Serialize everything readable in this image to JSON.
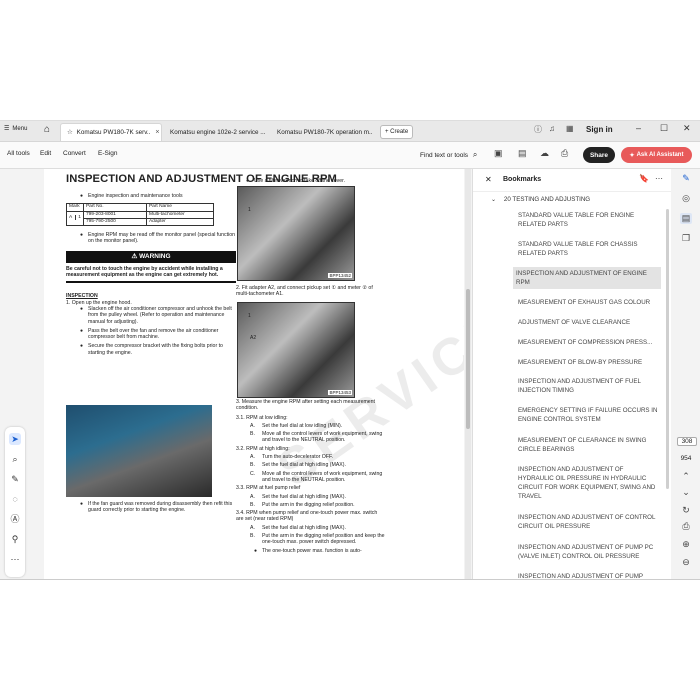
{
  "tabbar": {
    "menu_label": "Menu",
    "tabs": [
      {
        "label": "Komatsu PW180-7K serv.."
      },
      {
        "label": "Komatsu engine 102e-2 service ..."
      },
      {
        "label": "Komatsu PW180-7K operation m.."
      }
    ],
    "create_label": "+ Create",
    "sign_in_label": "Sign in"
  },
  "toolbar": {
    "all_tools": "All tools",
    "edit": "Edit",
    "convert": "Convert",
    "esign": "E-Sign",
    "find": "Find text or tools",
    "share": "Share",
    "ai_assistant": "Ask AI Assistant"
  },
  "document": {
    "title": "INSPECTION AND ADJUSTMENT OF ENGINE RPM",
    "left": {
      "tools_bullet": "Engine inspection and maintenance tools",
      "table_header": [
        "Mark",
        "Part No.",
        "Part Name"
      ],
      "table_rows": [
        [
          "1",
          "799-203-8001",
          "Multi-tachometer"
        ],
        [
          "2",
          "795-790-2500",
          "Adapter"
        ]
      ],
      "table_mark": "A",
      "monitor_bullet": "Engine RPM may be read off the monitor panel (special function on the monitor panel).",
      "warning_label": "⚠ WARNING",
      "warning_text": "Be careful not to touch the engine by accident while installing a measurement equipment as the engine can get extremely hot.",
      "inspection_heading": "INSPECTION",
      "step1": "1.   Open up the engine hood.",
      "bullets": [
        "Slacken off the air conditioner compressor and unhook the belt from the pulley wheel. (Refer to operation and maintenance manual for adjusting).",
        "Pass the belt over the fan and remove the air conditioner compressor belt from machine.",
        "Secure the compressor bracket with the fixing bolts prior to starting the engine."
      ],
      "fan_guard_bullet": "If the fan guard was removed during disassembly then refit this guard correctly prior to starting the engine."
    },
    "right": {
      "filter_bullet": "Use a filter wrench to take off the cover.",
      "photo1_label": "BPP13452",
      "photo1_callout": "1",
      "step2": "2.   Fit adapter A2, and connect pickup set ① and meter ② of multi-tachometer A1.",
      "photo2_label": "BPP13453",
      "photo2_callout_a2": "A2",
      "photo2_callout_1": "1",
      "step3": "3.   Measure the engine RPM after setting each measurement condition.",
      "s31": "3.1. RPM at low idling:",
      "s31_a": "Set the fuel dial at low idling (MIN).",
      "s31_b": "Move all the control levers of work equipment, swing and travel to the NEUTRAL position.",
      "s32": "3.2. RPM at high idling:",
      "s32_a": "Turn the auto-decelerator OFF.",
      "s32_b": "Set the fuel dial at high idling (MAX).",
      "s32_c": "Move all the control levers of work equipment, swing and travel to the NEUTRAL position.",
      "s33": "3.3. RPM at fuel pump relief",
      "s33_a": "Set the fuel dial at high idling (MAX).",
      "s33_b": "Put the arm in the digging relief position.",
      "s34": "3.4. RPM when pump relief and one-touch power max. switch are set (near rated RPM)",
      "s34_a": "Set the fuel dial at high idling (MAX).",
      "s34_b": "Put the arm in the digging relief position and keep the one-touch max. power switch depressed.",
      "s34_last": "The one-touch power max. function is auto-"
    },
    "watermark": "SERVICE.C"
  },
  "bookmarks": {
    "title": "Bookmarks",
    "parent": "20 TESTING AND ADJUSTING",
    "items": [
      "STANDARD VALUE TABLE FOR ENGINE RELATED PARTS",
      "STANDARD VALUE TABLE FOR CHASSIS RELATED PARTS",
      "INSPECTION AND ADJUSTMENT OF ENGINE RPM",
      "MEASUREMENT OF EXHAUST GAS COLOUR",
      "ADJUSTMENT OF VALVE CLEARANCE",
      "MEASUREMENT OF COMPRESSION PRESS...",
      "MEASUREMENT OF BLOW-BY PRESSURE",
      "INSPECTION AND ADJUSTMENT OF FUEL INJECTION TIMING",
      "EMERGENCY SETTING IF FAILURE OCCURS IN ENGINE CONTROL SYSTEM",
      "MEASUREMENT OF CLEARANCE IN SWING CIRCLE BEARINGS",
      "INSPECTION AND ADJUSTMENT OF HYDRAULIC OIL PRESSURE IN HYDRAULIC CIRCUIT FOR WORK EQUIPMENT, SWING AND TRAVEL",
      "INSPECTION AND ADJUSTMENT OF CONTROL CIRCUIT OIL PRESSURE",
      "INSPECTION AND ADJUSTMENT OF PUMP PC (VALVE INLET) CONTROL OIL PRESSURE",
      "INSPECTION AND ADJUSTMENT OF PUMP"
    ],
    "selected_index": 2
  },
  "pagination": {
    "current_page": "308",
    "total_pages": "954"
  }
}
